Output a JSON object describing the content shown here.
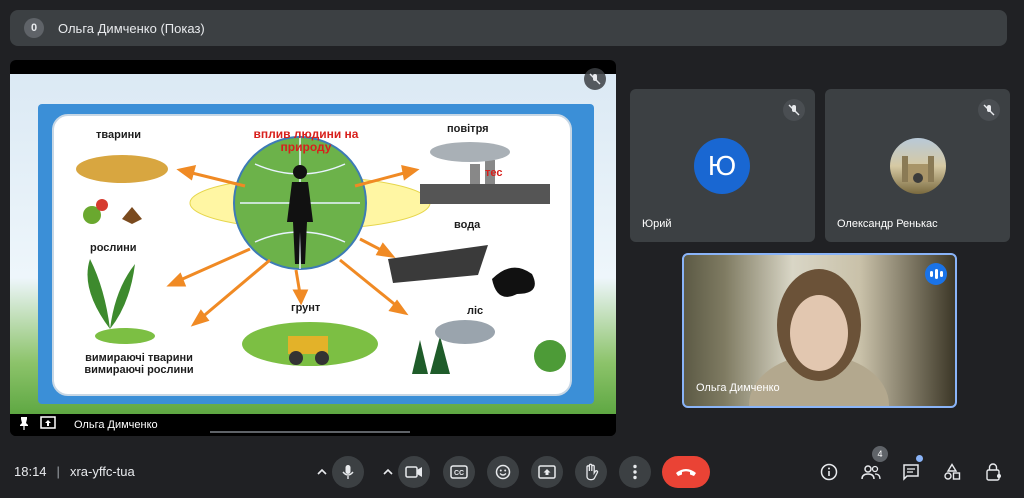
{
  "topbar": {
    "count": "0",
    "title": "Ольга Димченко (Показ)"
  },
  "presentation": {
    "presenter_name": "Ольга Димченко",
    "slide": {
      "title": "вплив людини на природу",
      "labels": {
        "animals": "тварини",
        "air": "повітря",
        "tec": "тес",
        "water": "вода",
        "plants": "рослини",
        "soil": "грунт",
        "forest": "ліс",
        "extinct": "вимираючі тварини вимираючі рослини"
      }
    }
  },
  "participants": [
    {
      "name": "Юрий",
      "initial": "Ю",
      "avatar_color": "#1967d2",
      "muted": true
    },
    {
      "name": "Олександр Ренькас",
      "muted": true
    },
    {
      "name": "Ольга Димченко",
      "speaking": true
    }
  ],
  "bottombar": {
    "time": "18:14",
    "meeting_code": "xra-yffc-tua",
    "people_count": "4"
  },
  "colors": {
    "background": "#202124",
    "tile": "#3c4043",
    "end_call": "#ea4335",
    "accent": "#8ab4f8"
  }
}
